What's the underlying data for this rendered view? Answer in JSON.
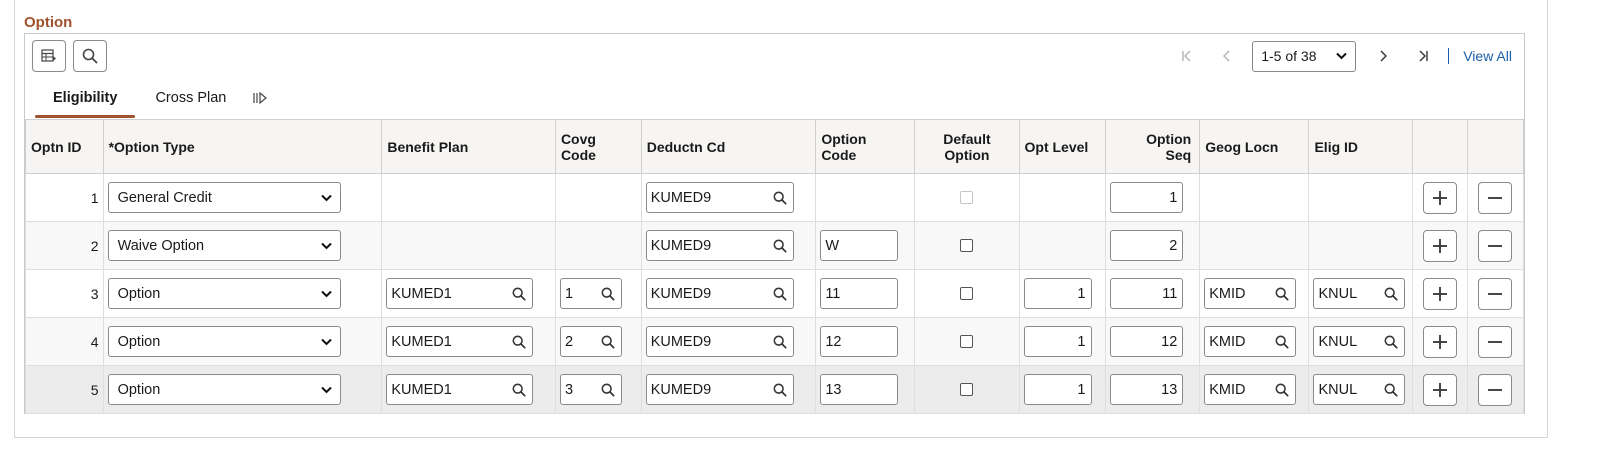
{
  "section": {
    "title": "Option"
  },
  "toolbar": {
    "personalize_icon": "grid-personalize-icon",
    "find_icon": "search-icon"
  },
  "pager": {
    "range": "1-5 of 38",
    "view_all": "View All"
  },
  "tabs": [
    {
      "label": "Eligibility",
      "active": true
    },
    {
      "label": "Cross Plan",
      "active": false
    }
  ],
  "columns": {
    "optn_id": "Optn ID",
    "option_type": "*Option Type",
    "benefit_plan": "Benefit Plan",
    "covg_code_1": "Covg",
    "covg_code_2": "Code",
    "deductn_cd": "Deductn Cd",
    "option_code_1": "Option",
    "option_code_2": "Code",
    "default_option_1": "Default",
    "default_option_2": "Option",
    "opt_level": "Opt Level",
    "option_seq_1": "Option",
    "option_seq_2": "Seq",
    "geog_locn": "Geog Locn",
    "elig_id": "Elig ID"
  },
  "rows": [
    {
      "id": "1",
      "option_type": "General Credit",
      "benefit_plan": "",
      "covg_code": "",
      "deductn_cd": "KUMED9",
      "option_code": "",
      "default_option": false,
      "default_disabled": true,
      "opt_level": "",
      "option_seq": "1",
      "geog_locn": "",
      "elig_id": ""
    },
    {
      "id": "2",
      "option_type": "Waive Option",
      "benefit_plan": "",
      "covg_code": "",
      "deductn_cd": "KUMED9",
      "option_code": "W",
      "default_option": false,
      "default_disabled": false,
      "opt_level": "",
      "option_seq": "2",
      "geog_locn": "",
      "elig_id": ""
    },
    {
      "id": "3",
      "option_type": "Option",
      "benefit_plan": "KUMED1",
      "covg_code": "1",
      "deductn_cd": "KUMED9",
      "option_code": "11",
      "default_option": false,
      "default_disabled": false,
      "opt_level": "1",
      "option_seq": "11",
      "geog_locn": "KMID",
      "elig_id": "KNUL"
    },
    {
      "id": "4",
      "option_type": "Option",
      "benefit_plan": "KUMED1",
      "covg_code": "2",
      "deductn_cd": "KUMED9",
      "option_code": "12",
      "default_option": false,
      "default_disabled": false,
      "opt_level": "1",
      "option_seq": "12",
      "geog_locn": "KMID",
      "elig_id": "KNUL"
    },
    {
      "id": "5",
      "option_type": "Option",
      "benefit_plan": "KUMED1",
      "covg_code": "3",
      "deductn_cd": "KUMED9",
      "option_code": "13",
      "default_option": false,
      "default_disabled": false,
      "opt_level": "1",
      "option_seq": "13",
      "geog_locn": "KMID",
      "elig_id": "KNUL"
    }
  ]
}
